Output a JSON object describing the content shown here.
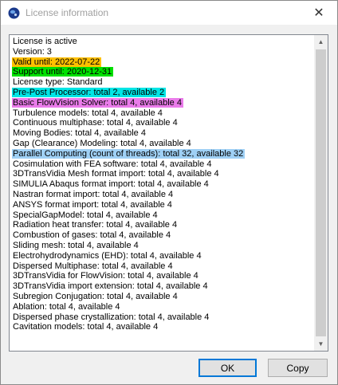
{
  "window": {
    "title": "License information",
    "close_glyph": "✕"
  },
  "lines": [
    {
      "text": "License is active",
      "highlight": ""
    },
    {
      "text": "Version: 3",
      "highlight": ""
    },
    {
      "text": "Valid until: 2022-07-22",
      "highlight": "#ffc000"
    },
    {
      "text": "Support until: 2020-12-31",
      "highlight": "#00e000"
    },
    {
      "text": "License type: Standard",
      "highlight": ""
    },
    {
      "text": "Pre-Post Processor: total 2, available 2",
      "highlight": "#00e5e5"
    },
    {
      "text": "Basic FlowVision Solver: total 4, available 4",
      "highlight": "#ea7bea"
    },
    {
      "text": "Turbulence models: total 4, available 4",
      "highlight": ""
    },
    {
      "text": "Continuous multiphase: total 4, available 4",
      "highlight": ""
    },
    {
      "text": "Moving Bodies: total 4, available 4",
      "highlight": ""
    },
    {
      "text": "Gap (Clearance) Modeling: total 4, available 4",
      "highlight": ""
    },
    {
      "text": "Parallel Computing (count of threads): total 32, available 32",
      "highlight": "#9fd0f5"
    },
    {
      "text": "Cosimulation with FEA software: total 4, available 4",
      "highlight": ""
    },
    {
      "text": "3DTransVidia Mesh format import: total 4, available 4",
      "highlight": ""
    },
    {
      "text": "SIMULIA Abaqus format import: total 4, available 4",
      "highlight": ""
    },
    {
      "text": "Nastran format import: total 4, available 4",
      "highlight": ""
    },
    {
      "text": "ANSYS format import: total 4, available 4",
      "highlight": ""
    },
    {
      "text": "SpecialGapModel: total 4, available 4",
      "highlight": ""
    },
    {
      "text": "Radiation heat transfer: total 4, available 4",
      "highlight": ""
    },
    {
      "text": "Combustion of gases: total 4, available 4",
      "highlight": ""
    },
    {
      "text": "Sliding mesh: total 4, available 4",
      "highlight": ""
    },
    {
      "text": "Electrohydrodynamics (EHD): total 4, available 4",
      "highlight": ""
    },
    {
      "text": "Dispersed Multiphase: total 4, available 4",
      "highlight": ""
    },
    {
      "text": "3DTransVidia for FlowVision: total 4, available 4",
      "highlight": ""
    },
    {
      "text": "3DTransVidia import extension: total 4, available 4",
      "highlight": ""
    },
    {
      "text": "Subregion Conjugation: total 4, available 4",
      "highlight": ""
    },
    {
      "text": "Ablation: total 4, available 4",
      "highlight": ""
    },
    {
      "text": "Dispersed phase crystallization: total 4, available 4",
      "highlight": ""
    },
    {
      "text": "Cavitation models: total 4, available 4",
      "highlight": ""
    }
  ],
  "buttons": {
    "ok_label": "OK",
    "copy_label": "Copy"
  },
  "icons": {
    "app": "flowvision-logo-icon",
    "close": "close-icon",
    "scroll_up": "scroll-up-arrow-icon",
    "scroll_down": "scroll-down-arrow-icon"
  }
}
